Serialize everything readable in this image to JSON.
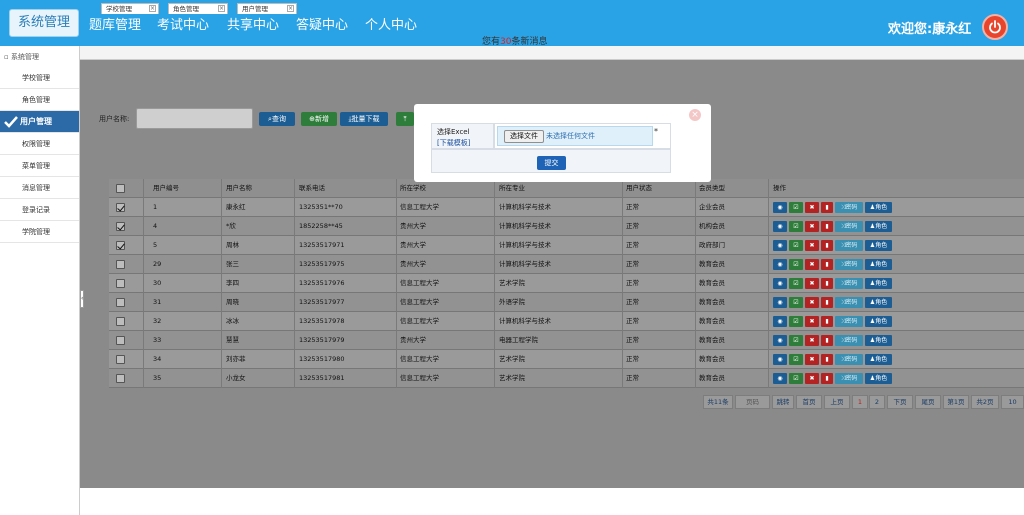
{
  "header": {
    "nav": [
      "系统管理",
      "题库管理",
      "考试中心",
      "共享中心",
      "答疑中心",
      "个人中心"
    ],
    "notice_prefix": "您有",
    "notice_count": "30",
    "notice_suffix": "条新消息",
    "welcome": "欢迎您:康永红",
    "color": "#2aa3e6"
  },
  "sidebar": {
    "title": "系统管理",
    "items": [
      "学校管理",
      "角色管理",
      "用户管理",
      "权限管理",
      "菜单管理",
      "消息管理",
      "登录记录",
      "学院管理"
    ],
    "active_index": 2
  },
  "tabs": [
    "学校管理",
    "角色管理",
    "用户管理"
  ],
  "toolbar": {
    "search_label": "用户名称:",
    "search_value": "",
    "query": "查询",
    "add": "新增",
    "bulk_download": "批量下载"
  },
  "table": {
    "columns": [
      "用户编号",
      "用户名称",
      "联系电话",
      "所在学校",
      "所在专业",
      "用户状态",
      "会员类型",
      "操作"
    ],
    "rows": [
      {
        "checked": true,
        "id": "1",
        "name": "康永红",
        "phone": "1325351**70",
        "school": "信息工程大学",
        "major": "计算机科学与技术",
        "status": "正常",
        "type": "企业会员"
      },
      {
        "checked": true,
        "id": "4",
        "name": "*欣",
        "phone": "1852258**45",
        "school": "贵州大学",
        "major": "计算机科学与技术",
        "status": "正常",
        "type": "机构会员"
      },
      {
        "checked": true,
        "id": "5",
        "name": "周林",
        "phone": "13253517971",
        "school": "贵州大学",
        "major": "计算机科学与技术",
        "status": "正常",
        "type": "政府部门"
      },
      {
        "checked": false,
        "id": "29",
        "name": "张三",
        "phone": "13253517975",
        "school": "贵州大学",
        "major": "计算机科学与技术",
        "status": "正常",
        "type": "教育会员"
      },
      {
        "checked": false,
        "id": "30",
        "name": "李四",
        "phone": "13253517976",
        "school": "信息工程大学",
        "major": "艺术学院",
        "status": "正常",
        "type": "教育会员"
      },
      {
        "checked": false,
        "id": "31",
        "name": "周晓",
        "phone": "13253517977",
        "school": "信息工程大学",
        "major": "外语学院",
        "status": "正常",
        "type": "教育会员"
      },
      {
        "checked": false,
        "id": "32",
        "name": "冰冰",
        "phone": "13253517978",
        "school": "信息工程大学",
        "major": "计算机科学与技术",
        "status": "正常",
        "type": "教育会员"
      },
      {
        "checked": false,
        "id": "33",
        "name": "慧慧",
        "phone": "13253517979",
        "school": "贵州大学",
        "major": "电器工程学院",
        "status": "正常",
        "type": "教育会员"
      },
      {
        "checked": false,
        "id": "34",
        "name": "刘亦菲",
        "phone": "13253517980",
        "school": "信息工程大学",
        "major": "艺术学院",
        "status": "正常",
        "type": "教育会员"
      },
      {
        "checked": false,
        "id": "35",
        "name": "小龙女",
        "phone": "13253517981",
        "school": "信息工程大学",
        "major": "艺术学院",
        "status": "正常",
        "type": "教育会员"
      }
    ],
    "ops": {
      "pwd": "密码",
      "role": "角色"
    }
  },
  "pager": [
    "共11条",
    "页码",
    "跳转",
    "首页",
    "上页",
    "1",
    "2",
    "下页",
    "尾页",
    "第1页",
    "共2页",
    "10"
  ],
  "modal": {
    "label": "选择Excel",
    "template_link": "[下载模板]",
    "choose_file": "选择文件",
    "no_file": "未选择任何文件",
    "required_mark": "*",
    "submit": "提交",
    "close": "×"
  }
}
